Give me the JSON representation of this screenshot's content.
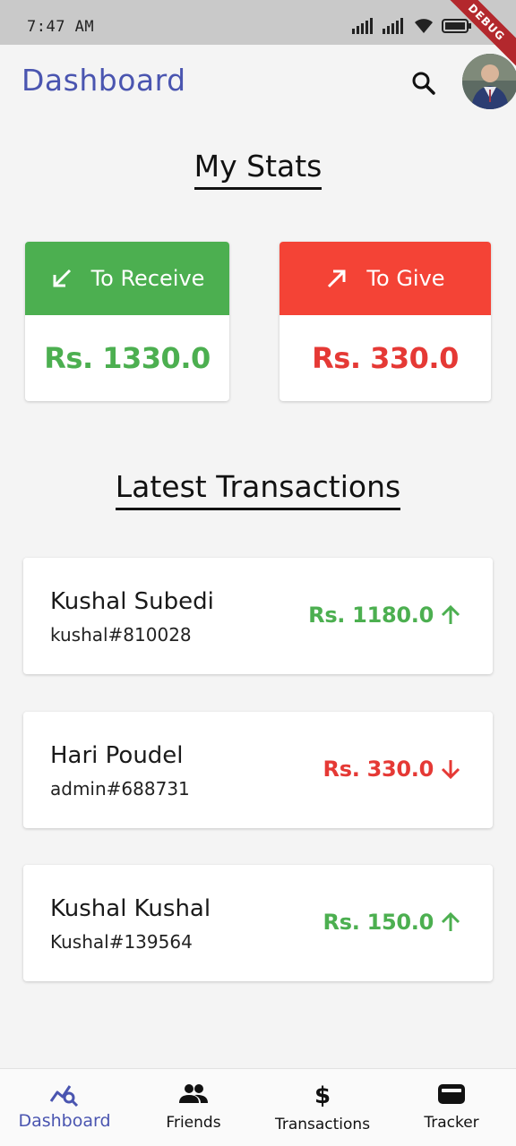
{
  "status_bar": {
    "time": "7:47 AM",
    "battery": "98",
    "debug": "DEBUG"
  },
  "app_bar": {
    "title": "Dashboard"
  },
  "stats": {
    "title": "My Stats",
    "receive": {
      "label": "To Receive",
      "amount": "Rs. 1330.0",
      "color": "#4caf50"
    },
    "give": {
      "label": "To Give",
      "amount": "Rs. 330.0",
      "color": "#f44336"
    }
  },
  "transactions": {
    "title": "Latest Transactions",
    "items": [
      {
        "name": "Kushal Subedi",
        "handle": "kushal#810028",
        "amount": "Rs. 1180.0",
        "direction": "up",
        "color": "#4caf50"
      },
      {
        "name": "Hari Poudel",
        "handle": "admin#688731",
        "amount": "Rs. 330.0",
        "direction": "down",
        "color": "#e53935"
      },
      {
        "name": "Kushal Kushal",
        "handle": "Kushal#139564",
        "amount": "Rs. 150.0",
        "direction": "up",
        "color": "#4caf50"
      }
    ]
  },
  "bottom_nav": {
    "items": [
      {
        "label": "Dashboard",
        "icon": "dashboard-chart-icon",
        "active": true
      },
      {
        "label": "Friends",
        "icon": "people-icon",
        "active": false
      },
      {
        "label": "Transactions",
        "icon": "dollar-icon",
        "active": false
      },
      {
        "label": "Tracker",
        "icon": "wallet-icon",
        "active": false
      }
    ],
    "accent": "#4a55b0"
  }
}
